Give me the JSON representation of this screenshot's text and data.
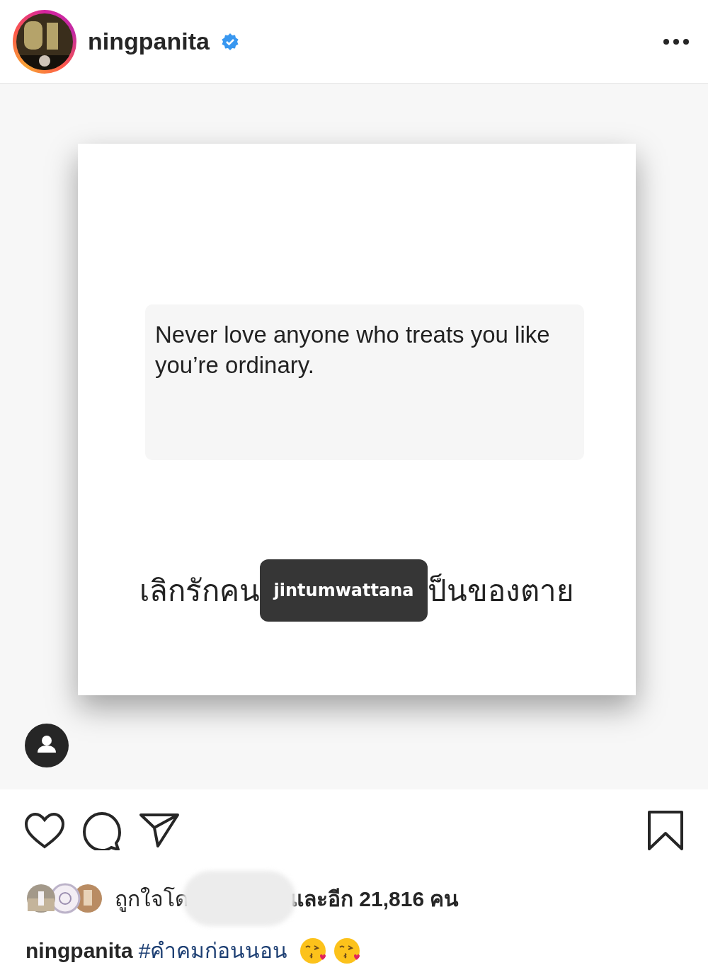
{
  "post": {
    "username": "ningpanita",
    "verified": true
  },
  "image": {
    "quote": "Never love anyone who treats you like you’re ordinary.",
    "thai_left": "เลิกรักคน",
    "thai_right": "ป็นของตาย",
    "tag": "jintumwattana"
  },
  "actions": {
    "liked": false,
    "saved": false
  },
  "likes": {
    "prefix": "ถูกใจโด",
    "suffix": "และอีก 21,816 คน"
  },
  "caption": {
    "username": "ningpanita",
    "hashtag": "#คำคมก่อนนอน"
  }
}
